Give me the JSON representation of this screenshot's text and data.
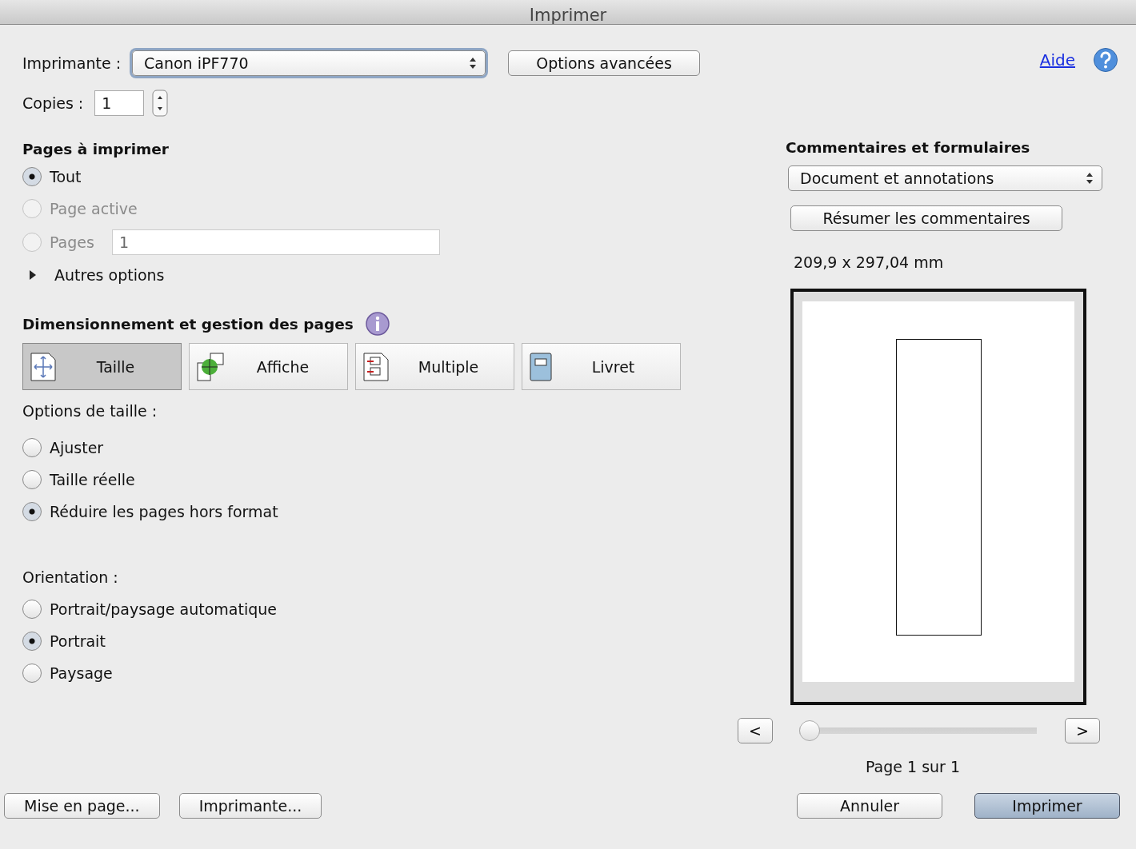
{
  "window": {
    "title": "Imprimer"
  },
  "printer": {
    "label": "Imprimante :",
    "value": "Canon iPF770",
    "advanced_button": "Options avancées"
  },
  "help": {
    "link": "Aide"
  },
  "copies": {
    "label": "Copies :",
    "value": "1"
  },
  "pages_to_print": {
    "title": "Pages à imprimer",
    "options": [
      {
        "kind": "radio",
        "label": "Tout",
        "selected": true,
        "disabled": false
      },
      {
        "kind": "radio",
        "label": "Page active",
        "selected": false,
        "disabled": true
      },
      {
        "kind": "range",
        "label": "Pages",
        "selected": false,
        "disabled": true,
        "value": "1"
      }
    ],
    "more_options": {
      "label": "Autres options",
      "expanded": false
    }
  },
  "sizing": {
    "title": "Dimensionnement et gestion des pages",
    "modes": [
      {
        "kind": "size",
        "label": "Taille",
        "selected": true
      },
      {
        "kind": "poster",
        "label": "Affiche",
        "selected": false
      },
      {
        "kind": "multiple",
        "label": "Multiple",
        "selected": false
      },
      {
        "kind": "booklet",
        "label": "Livret",
        "selected": false
      }
    ],
    "options_label": "Options de taille :",
    "options": [
      {
        "label": "Ajuster",
        "selected": false
      },
      {
        "label": "Taille réelle",
        "selected": false
      },
      {
        "label": "Réduire les pages hors format",
        "selected": true
      }
    ]
  },
  "orientation": {
    "label": "Orientation :",
    "options": [
      {
        "label": "Portrait/paysage automatique",
        "selected": false
      },
      {
        "label": "Portrait",
        "selected": true
      },
      {
        "label": "Paysage",
        "selected": false
      }
    ]
  },
  "comments": {
    "title": "Commentaires et formulaires",
    "value": "Document et annotations",
    "summarize_button": "Résumer les commentaires",
    "page_size": "209,9 x 297,04 mm"
  },
  "preview": {
    "prev_button": "<",
    "next_button": ">",
    "slider": {
      "level": 0
    },
    "page_indicator": "Page 1 sur 1"
  },
  "footer": {
    "left_buttons": [
      "Mise en page...",
      "Imprimante..."
    ],
    "cancel_button": "Annuler",
    "print_button": "Imprimer"
  }
}
